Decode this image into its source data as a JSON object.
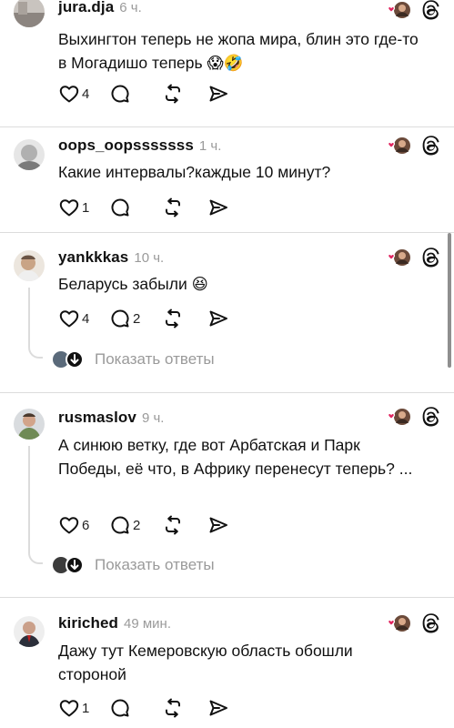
{
  "comments": [
    {
      "username": "jura.dja",
      "time": "6 ч.",
      "text": "Выхингтон теперь не жопа мира, блин это где-то в Могадишо теперь 😱🤣",
      "likes": "4",
      "replies_count": ""
    },
    {
      "username": "oops_oopsssssss",
      "time": "1 ч.",
      "text": "Какие интервалы?каждые 10 минут?",
      "likes": "1",
      "replies_count": ""
    },
    {
      "username": "yankkkas",
      "time": "10 ч.",
      "text": "Беларусь забыли 😆",
      "likes": "4",
      "replies_count": "2",
      "show_replies": "Показать ответы"
    },
    {
      "username": "rusmaslov",
      "time": "9 ч.",
      "text": "А синюю ветку, где вот Арбатская и Парк Победы, её что, в Африку перенесут теперь? ...",
      "likes": "6",
      "replies_count": "2",
      "show_replies": "Показать ответы"
    },
    {
      "username": "kiriched",
      "time": "49 мин.",
      "text": "Дажу тут Кемеровскую область обошли стороной",
      "likes": "1",
      "replies_count": ""
    }
  ],
  "icons": {
    "like": "heart-outline-icon",
    "reply": "speech-bubble-icon",
    "repost": "repost-icon",
    "share": "send-icon",
    "badge": "heart-avatar-badge-icon",
    "platform": "threads-logo-icon"
  },
  "colors": {
    "text": "#111111",
    "muted": "#9a9a9a",
    "divider": "#dcdcdc",
    "heart": "#e0245e"
  }
}
